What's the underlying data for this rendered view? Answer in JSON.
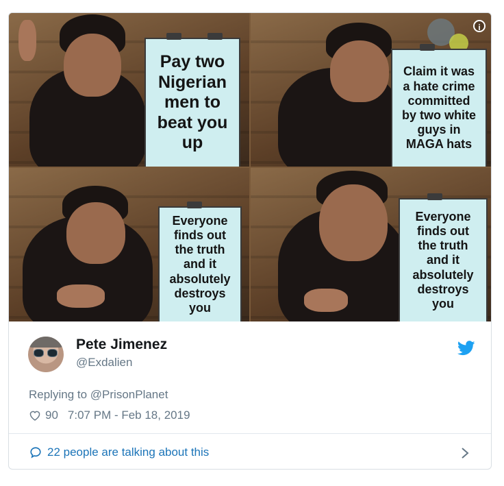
{
  "meme": {
    "panel1_text": [
      "Pay two",
      "Nigerian",
      "men to",
      "beat you",
      "up"
    ],
    "panel2_text": [
      "Claim it was",
      "a hate crime",
      "committed",
      "by two white",
      "guys in",
      "MAGA hats"
    ],
    "panel3_text": [
      "Everyone",
      "finds out",
      "the truth",
      "and it",
      "absolutely",
      "destroys",
      "you"
    ],
    "panel4_text": [
      "Everyone",
      "finds out",
      "the truth",
      "and it",
      "absolutely",
      "destroys",
      "you"
    ]
  },
  "info_icon": "info-icon",
  "author": {
    "display_name": "Pete Jimenez",
    "handle": "@Exdalien"
  },
  "reply": {
    "prefix": "Replying to ",
    "target": "@PrisonPlanet"
  },
  "meta": {
    "like_count": "90",
    "timestamp": "7:07 PM - Feb 18, 2019"
  },
  "conversation": {
    "label": "22 people are talking about this"
  },
  "colors": {
    "twitter_blue": "#1da1f2",
    "link_blue": "#1b74b8",
    "muted_gray": "#657786",
    "board": "#cfeef0"
  }
}
